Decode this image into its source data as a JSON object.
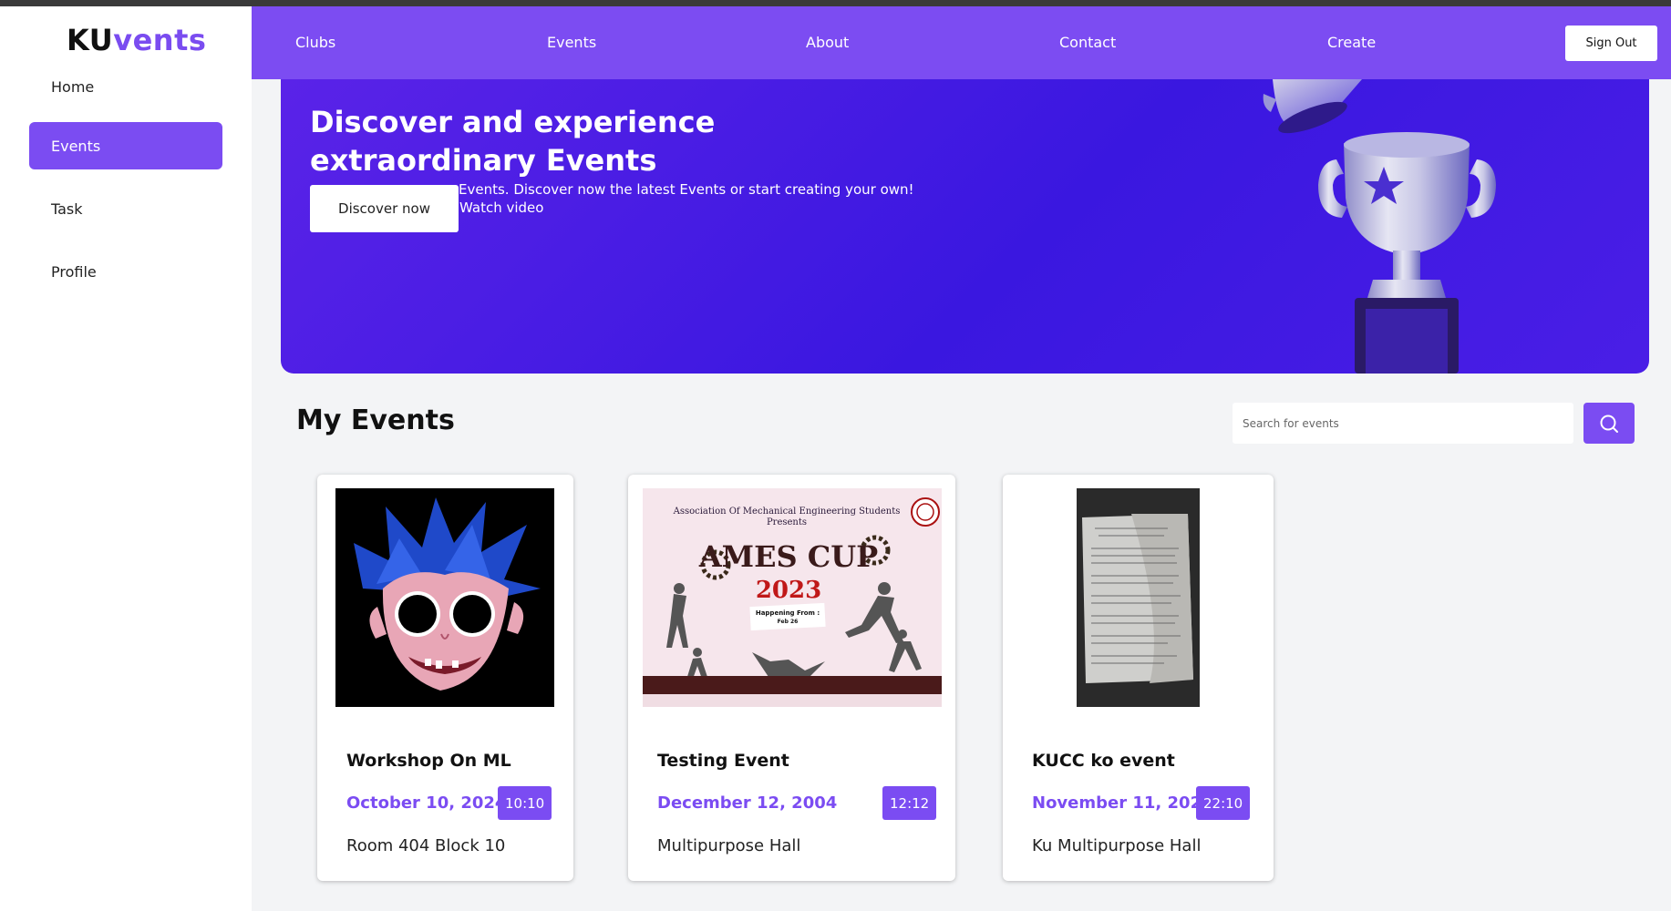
{
  "sidebar": {
    "logo_ku": "KU",
    "logo_vents": "vents",
    "items": [
      {
        "label": "Home"
      },
      {
        "label": "Events"
      },
      {
        "label": "Task"
      },
      {
        "label": "Profile"
      }
    ],
    "active_item": "Events"
  },
  "topnav": {
    "links": [
      "Clubs",
      "Events",
      "About",
      "Contact",
      "Create"
    ],
    "signout_label": "Sign Out"
  },
  "hero": {
    "title": "Discover and experience extraordinary Events",
    "subtitle": "Events. Discover now the latest Events or start creating your own!",
    "discover_label": "Discover now",
    "watch_label": "Watch video"
  },
  "my_events": {
    "title": "My Events",
    "search_placeholder": "Search for events",
    "search_icon": "search-icon"
  },
  "events": [
    {
      "title": "Workshop On ML",
      "date": "October 10, 2024",
      "time": "10:10",
      "venue": "Room 404 Block 10",
      "image": "cartoon-avatar"
    },
    {
      "title": "Testing Event",
      "date": "December 12, 2004",
      "time": "12:12",
      "venue": "Multipurpose Hall",
      "image": "ames-cup-poster"
    },
    {
      "title": "KUCC ko event",
      "date": "November 11, 2020",
      "time": "22:10",
      "venue": "Ku Multipurpose Hall",
      "image": "document-photo"
    }
  ],
  "poster": {
    "line1": "Association Of Mechanical Engineering Students",
    "line2": "Presents",
    "name": "AMES CUP",
    "year": "2023",
    "happening": "Happening From :",
    "date": "Feb 26"
  },
  "colors": {
    "accent": "#7b4cf2",
    "nav": "#7c4cf2",
    "hero": "#4a1ee6"
  }
}
